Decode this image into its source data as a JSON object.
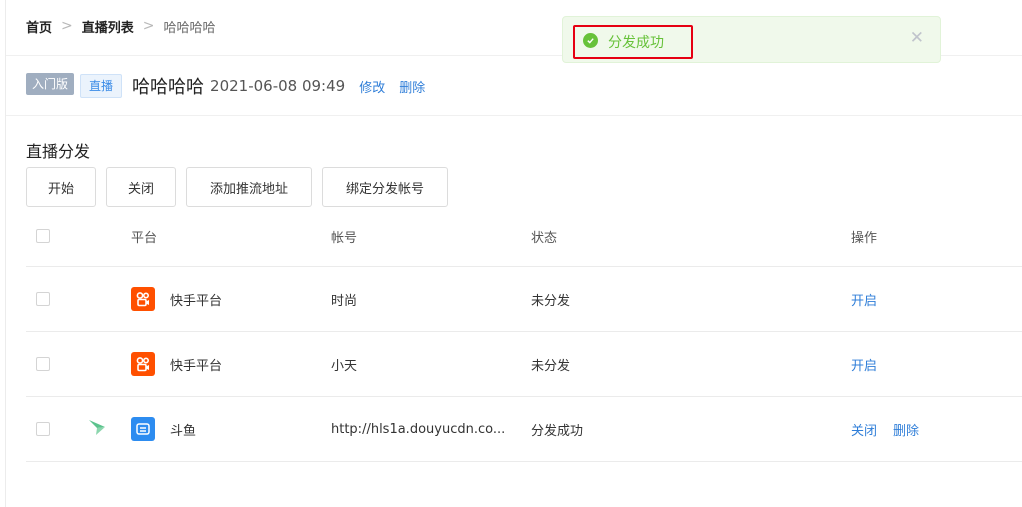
{
  "breadcrumb": {
    "home": "首页",
    "list": "直播列表",
    "current": "哈哈哈哈",
    "separator": ">"
  },
  "header": {
    "edition_tag": "入门版",
    "type_tag": "直播",
    "title": "哈哈哈哈",
    "datetime": "2021-06-08 09:49",
    "edit_label": "修改",
    "delete_label": "删除"
  },
  "section": {
    "title": "直播分发"
  },
  "toolbar": {
    "start_label": "开始",
    "close_label": "关闭",
    "add_push_label": "添加推流地址",
    "bind_account_label": "绑定分发帐号"
  },
  "table": {
    "columns": {
      "platform": "平台",
      "account": "帐号",
      "status": "状态",
      "action": "操作"
    },
    "rows": [
      {
        "platform": "快手平台",
        "platform_icon": "kuaishou-icon",
        "account": "时尚",
        "status": "未分发",
        "actions": [
          "开启"
        ]
      },
      {
        "platform": "快手平台",
        "platform_icon": "kuaishou-icon",
        "account": "小天",
        "status": "未分发",
        "actions": [
          "开启"
        ]
      },
      {
        "platform": "斗鱼",
        "platform_icon": "douyu-icon",
        "row_mark_icon": "paper-plane-icon",
        "account": "http://hls1a.douyucdn.co...",
        "status": "分发成功",
        "actions": [
          "关闭",
          "删除"
        ]
      }
    ]
  },
  "toast": {
    "message": "分发成功",
    "close_symbol": "✕",
    "icon": "check-circle-icon"
  },
  "colors": {
    "link": "#2f7ed8",
    "success": "#67c23a",
    "kuaishou": "#ff5000",
    "douyu": "#2d8cf0",
    "highlight": "#e60012"
  }
}
